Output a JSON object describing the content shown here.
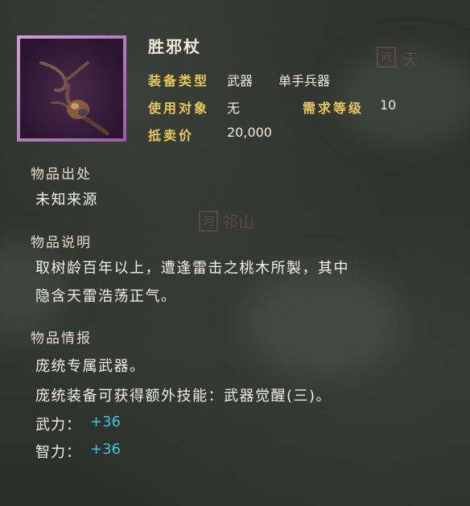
{
  "background": {
    "map_label": "祁山",
    "tags": [
      "河",
      "河"
    ],
    "map_label_right": "天"
  },
  "item": {
    "name": "胜邪杖",
    "icon": "staff-icon",
    "frame_color": "#b77ec2"
  },
  "stats": {
    "type_label": "装备类型",
    "type_value": "武器",
    "subtype_value": "单手兵器",
    "target_label": "使用对象",
    "target_value": "无",
    "level_label": "需求等级",
    "level_value": "10",
    "price_label": "抵卖价",
    "price_value": "20,000"
  },
  "sections": {
    "origin_title": "物品出处",
    "origin_text": "未知来源",
    "desc_title": "物品说明",
    "desc_line1": "取树龄百年以上，遭逢雷击之桃木所製，其中",
    "desc_line2": "隐含天雷浩荡正气。",
    "info_title": "物品情报",
    "info_line1": "庞统专属武器。",
    "info_line2": "庞统装备可获得额外技能：武器觉醒(三)。"
  },
  "bonuses": [
    {
      "label": "武力：",
      "value": "+36"
    },
    {
      "label": "智力：",
      "value": "+36"
    }
  ],
  "colors": {
    "label_gold": "#e8c85a",
    "bonus_cyan": "#38c6d8",
    "text": "#f5f0e6"
  }
}
